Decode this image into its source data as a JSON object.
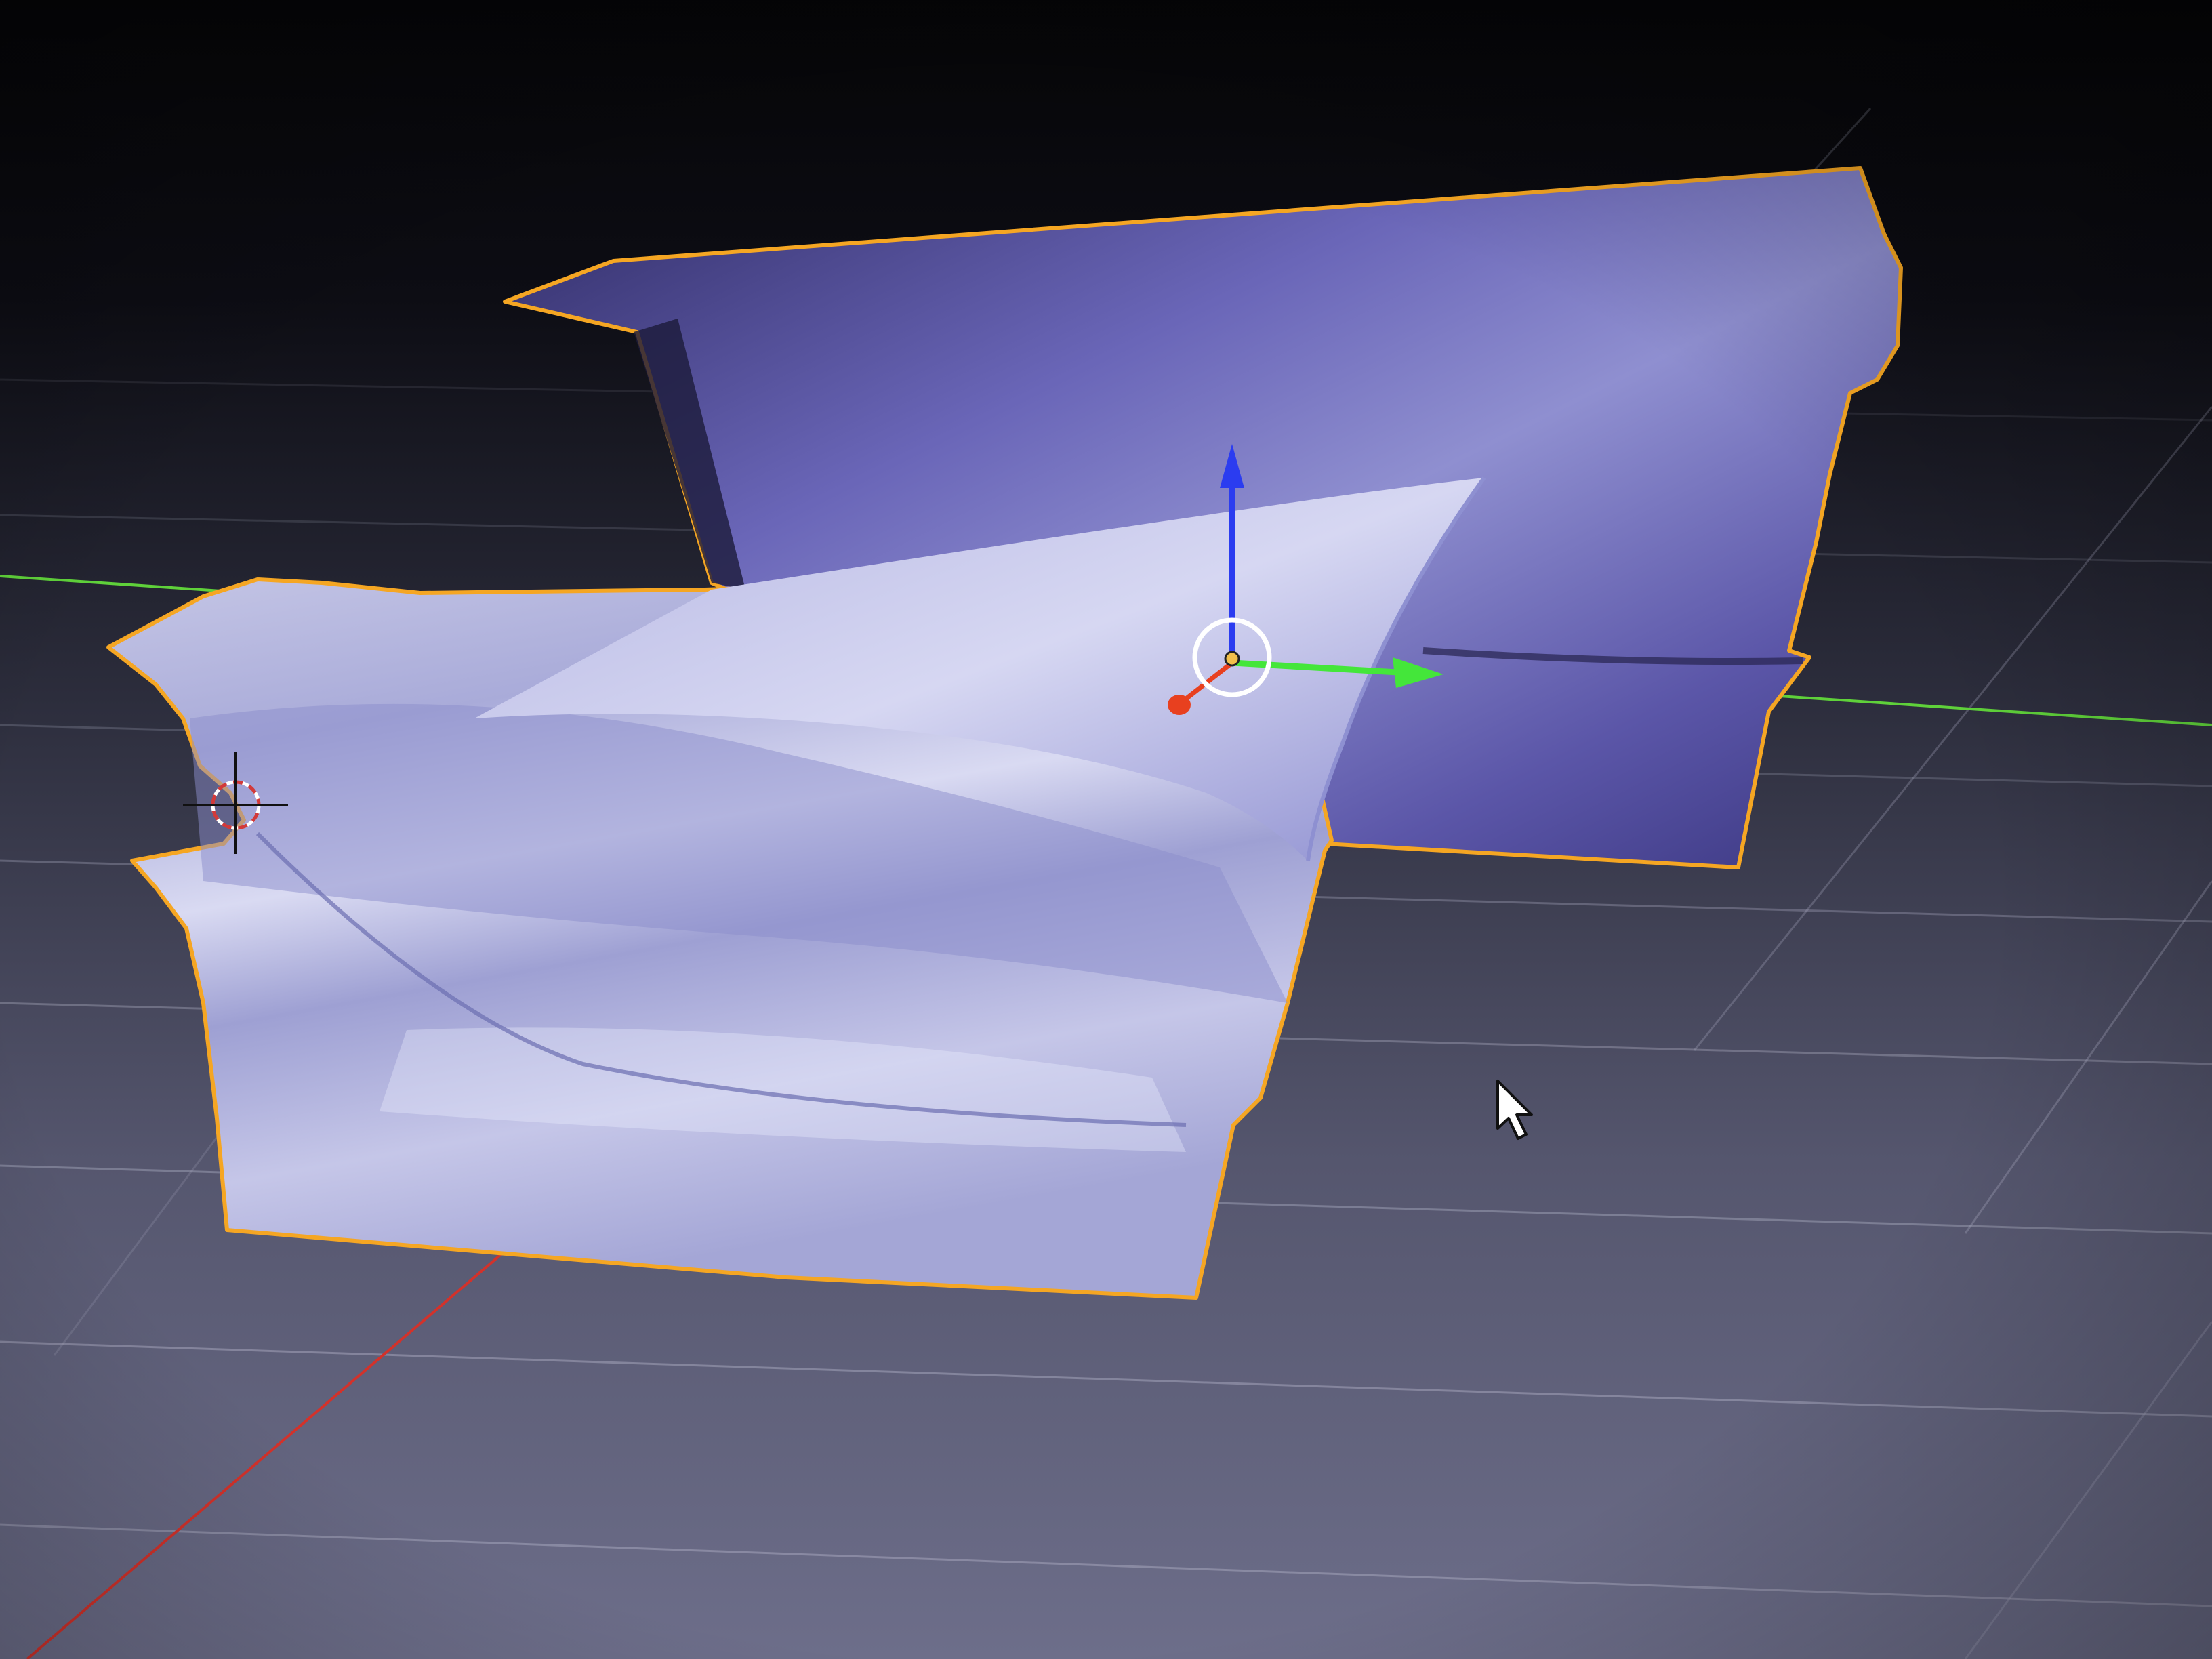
{
  "app": {
    "view": "3d-viewport",
    "view_label": ""
  },
  "colors": {
    "background_top": "#050507",
    "background_bottom": "#6d6e8a",
    "grid_line": "#a9aabf",
    "axis_x": "#d2322b",
    "axis_y": "#5fd13a",
    "selection_outline": "#f5a623",
    "mesh_light": "#c7c8e8",
    "mesh_dark": "#4a4690",
    "gizmo_z": "#2b3cf0",
    "gizmo_y": "#44e63a",
    "gizmo_x": "#e8401f",
    "gizmo_ring": "#ffffff",
    "cursor_3d": "#d23a3a"
  },
  "scene": {
    "objects": [
      {
        "name": "",
        "selected": true,
        "type": "mesh-panel-back"
      },
      {
        "name": "",
        "selected": true,
        "type": "mesh-panel-front"
      }
    ],
    "transform_gizmo": {
      "mode": "translate",
      "axes": [
        "x",
        "y",
        "z"
      ]
    },
    "cursor_3d": {
      "visible": true
    },
    "mouse_pointer": {
      "visible": true
    }
  }
}
